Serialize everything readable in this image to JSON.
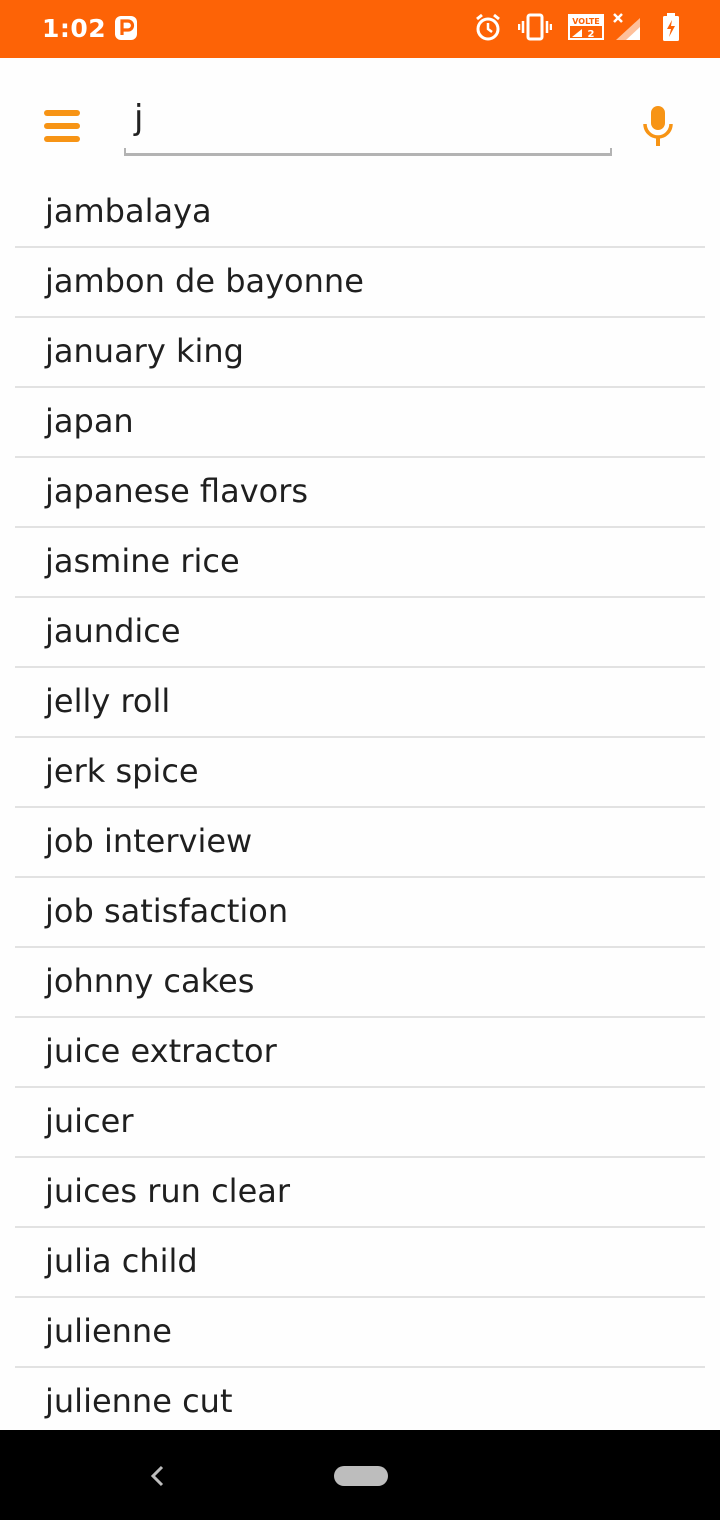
{
  "status_bar": {
    "time": "1:02",
    "notification_icon": "parking-p-icon",
    "volte_label": "VOLTE",
    "volte_sim": "2",
    "icons": [
      "alarm-icon",
      "vibrate-icon",
      "volte-icon",
      "signal-no-data-icon",
      "battery-charging-icon"
    ],
    "background_color": "#fd6306"
  },
  "search": {
    "query": "j",
    "menu_icon": "hamburger-menu-icon",
    "mic_icon": "microphone-icon",
    "accent_color": "#f79415"
  },
  "suggestions": [
    "jambalaya",
    "jambon de bayonne",
    "january king",
    "japan",
    "japanese flavors",
    "jasmine rice",
    "jaundice",
    "jelly roll",
    "jerk spice",
    "job interview",
    "job satisfaction",
    "johnny cakes",
    "juice extractor",
    "juicer",
    "juices run clear",
    "julia child",
    "julienne",
    "julienne cut"
  ],
  "nav_bar": {
    "icons": [
      "back-icon",
      "home-pill-icon"
    ]
  }
}
